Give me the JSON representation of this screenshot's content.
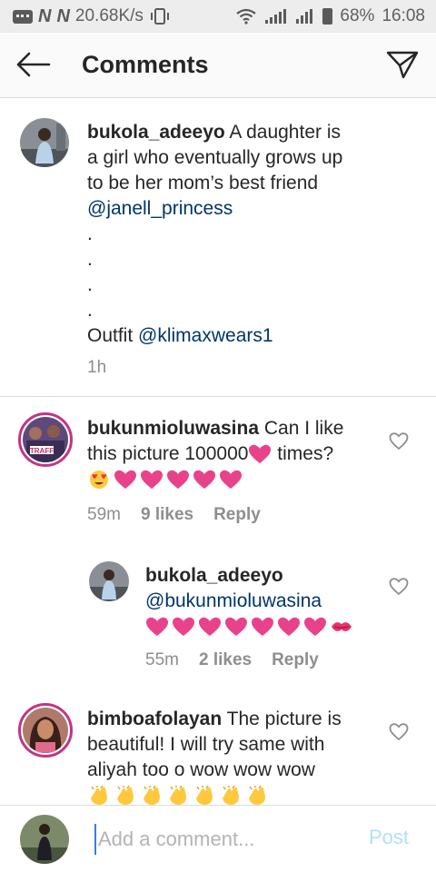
{
  "status_bar": {
    "speed": "20.68K/s",
    "battery": "68%",
    "time": "16:08"
  },
  "header": {
    "title": "Comments",
    "back_icon": "arrow-left-icon",
    "share_icon": "paper-plane-icon"
  },
  "comments": [
    {
      "username": "bukola_adeeyo",
      "text_line1": " A daughter is",
      "text_line2": "a girl who eventually grows up",
      "text_line3": "to be her  mom’s best friend",
      "mention": "@janell_princess",
      "dots": [
        ".",
        ".",
        ".",
        "."
      ],
      "outfit_label": "Outfit ",
      "outfit_mention": "@klimaxwears1",
      "time": "1h"
    },
    {
      "username": "bukunmioluwasina",
      "text_line1": " Can I like",
      "text_line2_a": "this picture 100000",
      "text_line2_b": " times?",
      "time": "59m",
      "likes": "9 likes",
      "reply": "Reply",
      "avatar_badge": "TRAFF"
    },
    {
      "username": "bukola_adeeyo",
      "mention": "@bukunmioluwasina",
      "time": "55m",
      "likes": "2 likes",
      "reply": "Reply"
    },
    {
      "username": "bimboafolayan",
      "text_line1": " The picture is",
      "text_line2": "beautiful! I will try same with",
      "text_line3": "aliyah too o wow wow wow"
    }
  ],
  "composer": {
    "placeholder": "Add a comment...",
    "post_label": "Post"
  },
  "colors": {
    "mention": "#003569",
    "heart_emoji": "#e8438a",
    "post_disabled": "#b2dffc",
    "story_ring": "#c13584"
  }
}
